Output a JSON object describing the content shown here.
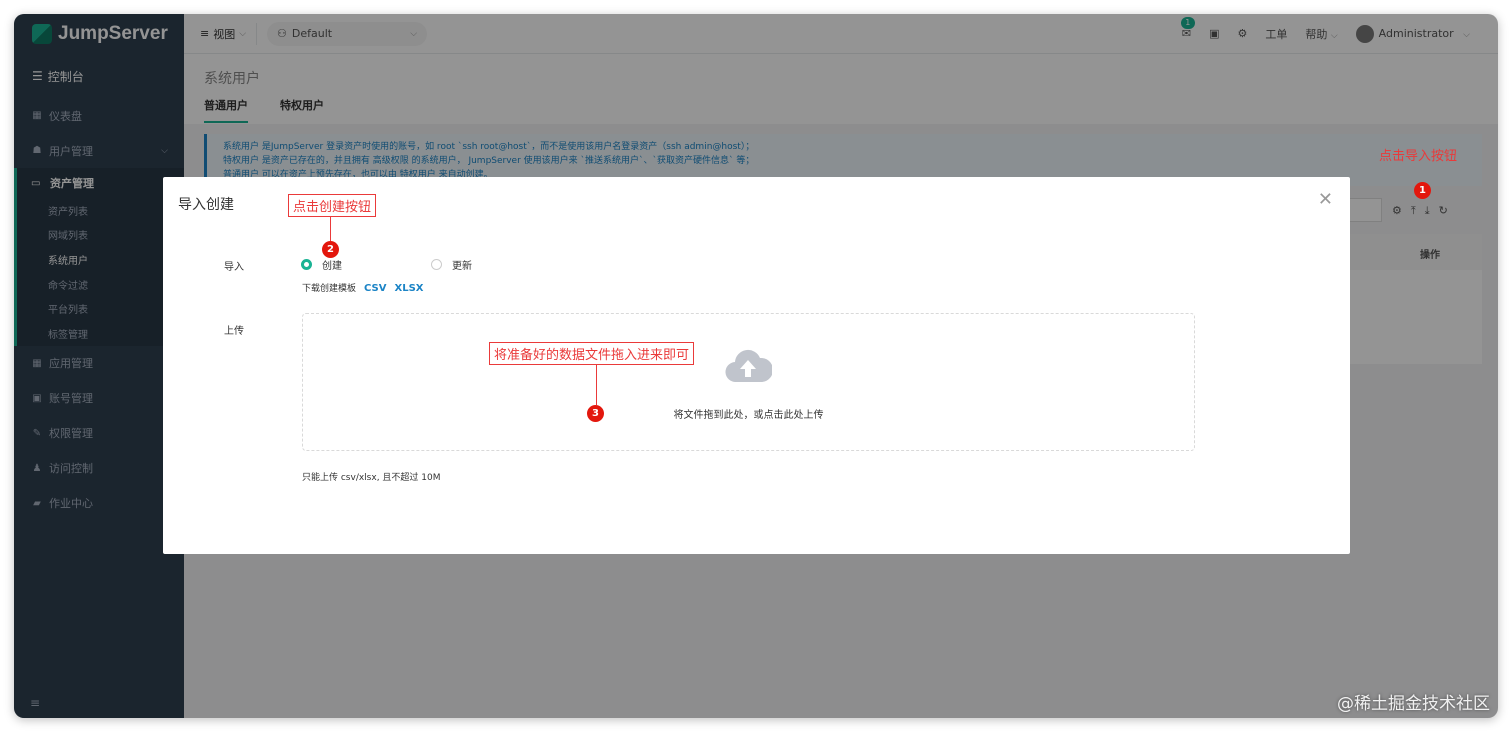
{
  "brand": {
    "name": "JumpServer",
    "accent": "#1ab394",
    "sidebar_bg": "#2f4050"
  },
  "sidebar": {
    "console": "控制台",
    "items": [
      {
        "label": "仪表盘",
        "icon": "dashboard-icon"
      },
      {
        "label": "用户管理",
        "icon": "users-icon",
        "chevron": "⌵"
      },
      {
        "label": "应用管理",
        "icon": "grid-icon"
      },
      {
        "label": "账号管理",
        "icon": "account-icon"
      },
      {
        "label": "权限管理",
        "icon": "edit-icon"
      },
      {
        "label": "访问控制",
        "icon": "access-icon"
      },
      {
        "label": "作业中心",
        "icon": "job-icon"
      }
    ],
    "active_group": {
      "label": "资产管理",
      "subitems": [
        "资产列表",
        "网域列表",
        "系统用户",
        "命令过滤",
        "平台列表",
        "标签管理"
      ],
      "selected": "系统用户"
    },
    "bottom_icon": "≡"
  },
  "header": {
    "view_label": "视图",
    "org": "Default",
    "mail_badge": "1",
    "ticket_label": "工单",
    "help_label": "帮助",
    "user": "Administrator"
  },
  "page": {
    "title": "系统用户",
    "tabs": [
      "普通用户",
      "特权用户"
    ],
    "info_lines": [
      "系统用户 是JumpServer 登录资产时使用的账号，如 root `ssh root@host`，而不是使用该用户名登录资产（ssh admin@host）；",
      "特权用户 是资产已存在的，并且拥有 高级权限 的系统用户， JumpServer 使用该用户来 `推送系统用户`、`获取资产硬件信息` 等；",
      "普通用户 可以在资产上预先存在，也可以由 特权用户 来自动创建。"
    ],
    "table_op_header": "操作"
  },
  "modal": {
    "title": "导入创建",
    "import_label": "导入",
    "radio_create": "创建",
    "radio_update": "更新",
    "template_label": "下载创建模板",
    "csv": "CSV",
    "xlsx": "XLSX",
    "upload_label": "上传",
    "drop_text": "将文件拖到此处，或点击此处上传",
    "limit_text": "只能上传 csv/xlsx, 且不超过 10M"
  },
  "annotations": {
    "import_hint": "点击导入按钮",
    "create_hint": "点击创建按钮",
    "drop_hint": "将准备好的数据文件拖入进来即可",
    "n1": "1",
    "n2": "2",
    "n3": "3",
    "color": "#ea3a3a"
  },
  "watermark": "@稀土掘金技术社区"
}
